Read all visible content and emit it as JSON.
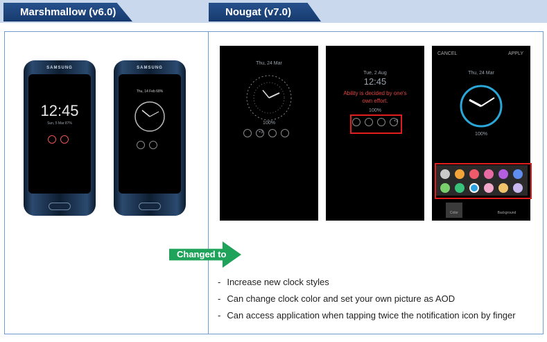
{
  "tabs": {
    "marshmallow": "Marshmallow (v6.0)",
    "nougat": "Nougat (v7.0)"
  },
  "marshmallow_phones": [
    {
      "brand": "SAMSUNG",
      "time": "12:45",
      "date": "Sun, 5 Mar 87%"
    },
    {
      "brand": "SAMSUNG",
      "status": "Thu, 14 Feb 68%"
    }
  ],
  "nougat_screens": [
    {
      "date": "Thu, 24 Mar",
      "battery": "100%",
      "extra": "+3"
    },
    {
      "date": "Tue, 2 Aug",
      "time": "12:45",
      "message": "Ability is decided by one's own effort.",
      "battery": "100%",
      "extra": "+3"
    },
    {
      "cancel": "CANCEL",
      "apply": "APPLY",
      "date": "Thu, 24 Mar",
      "battery": "100%",
      "color_label": "Color",
      "background_label": "Background"
    }
  ],
  "palette": [
    "#c9c9c9",
    "#f2a33a",
    "#ef5b6b",
    "#e86aa3",
    "#b45fe0",
    "#5f8df0",
    "#79cf6c",
    "#39c27a",
    "#2aa0e0",
    "#f2a9c9",
    "#f0c46b",
    "#c9b8f0"
  ],
  "changed_to": "Changed to",
  "bullets": [
    "Increase new clock styles",
    "Can change clock color and set your own picture as AOD",
    "Can access application when tapping twice the notification icon by finger"
  ]
}
